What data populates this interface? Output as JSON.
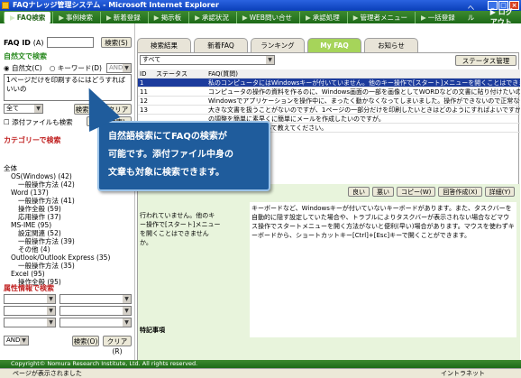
{
  "window": {
    "title": "FAQナレッジ管理システム - Microsoft Internet Explorer"
  },
  "menu": {
    "items": [
      "FAQ検索",
      "事例検索",
      "新着登録",
      "掲示板",
      "承認状況",
      "WEB問い合せ",
      "承認処理",
      "管理者メニュー",
      "一括登録"
    ],
    "help": "ヘルプ",
    "logout": "ログアウト"
  },
  "left": {
    "faq_id_label": "FAQ ID",
    "faq_id_help": "(A)",
    "search_btn": "検索(S)",
    "fulltext_title": "自然文で検索",
    "radio_natural": "自然文(C)",
    "radio_keyword": "キーワード(D)",
    "and_label": "AND",
    "query_text": "1ページだけを印刷するにはどうすればいいの",
    "scope_all": "全て",
    "scope_btn": "検索(G)",
    "clear_btn": "クリア",
    "attach_check": "添付ファイルも検索",
    "attach_btn": "貼付(検索)",
    "category_title": "カテゴリーで検索",
    "tree": [
      {
        "t": "全体",
        "lvl": 0
      },
      {
        "t": "OS(Windows) (42)",
        "lvl": 1
      },
      {
        "t": "一般操作方法 (42)",
        "lvl": 2
      },
      {
        "t": "Word (137)",
        "lvl": 1
      },
      {
        "t": "一般操作方法 (41)",
        "lvl": 2
      },
      {
        "t": "操作全般 (59)",
        "lvl": 2
      },
      {
        "t": "応用操作 (37)",
        "lvl": 2
      },
      {
        "t": "MS-IME (95)",
        "lvl": 1
      },
      {
        "t": "設定関連 (52)",
        "lvl": 2
      },
      {
        "t": "一般操作方法 (39)",
        "lvl": 2
      },
      {
        "t": "その他 (4)",
        "lvl": 2
      },
      {
        "t": "Outlook/Outlook Express (35)",
        "lvl": 1
      },
      {
        "t": "一般操作方法 (35)",
        "lvl": 2
      },
      {
        "t": "Excel (95)",
        "lvl": 1
      },
      {
        "t": "操作全般 (95)",
        "lvl": 2
      }
    ],
    "attr_title": "属性情報で検索",
    "attr_and": "AND",
    "attr_search": "検索(O)",
    "attr_clear": "クリア(R)"
  },
  "tabs": [
    "検索結果",
    "新着FAQ",
    "ランキング",
    "My FAQ",
    "お知らせ"
  ],
  "results": {
    "filter": "すべて",
    "status_mgmt": "ステータス管理",
    "headers": [
      "ID",
      "ステータス",
      "FAQ(質問)"
    ],
    "rows": [
      [
        "1",
        "",
        "私のコンピュータにはWindowsキーが付いていません。他のキー操作で[スタート]メニューを開くことはできませ"
      ],
      [
        "11",
        "",
        "コンピュータの操作の資料を作るのに、Windows画面の一部を画像としてWORDなどの文書に貼り付けたいの"
      ],
      [
        "12",
        "",
        "Windowsでアプリケーションを操作中に、まったく動かなくなってしまいました。操作ができないので正常な作業"
      ],
      [
        "13",
        "",
        "大きな文書を扱うことがないのですが、1ページの一部分だけを印刷したいときはどのようにすればよいですか"
      ],
      [
        "",
        "",
        "の調整を簡単に素早くに簡単にメールを作成したいのですが。"
      ],
      [
        "",
        "",
        "の調整する方法について教えてください。"
      ]
    ]
  },
  "detail": {
    "buttons": [
      "良い",
      "悪い",
      "コピー(W)",
      "回答作成(X)",
      "詳細(Y)"
    ],
    "question": "行われていません。他のキー操作で[スタート]メニューを開くことはできませんか。",
    "answer": "キーボードなど、Windowsキーが付いていないキーボードがあります。また、タスクバーを自動的に隠す設定していた場合や、トラブルによりタスクバーが表示されない場合などマウス操作でスタートメニューを開く方法がないと便利(早い)場合があります。マウスを使わずキーボードから、ショートカットキー[Ctrl]+[Esc]キーで開くことができます。",
    "special_label": "特記事項"
  },
  "callout": {
    "lines": [
      "自然語検索にてFAQの検索が",
      "可能です。添付ファイル中身の",
      "文章も対象に検索できます。"
    ]
  },
  "footer": "Copyright© Nomura Research Institute, Ltd. All rights reserved.",
  "status": {
    "left": "ページが表示されました",
    "zone": "イントラネット"
  }
}
